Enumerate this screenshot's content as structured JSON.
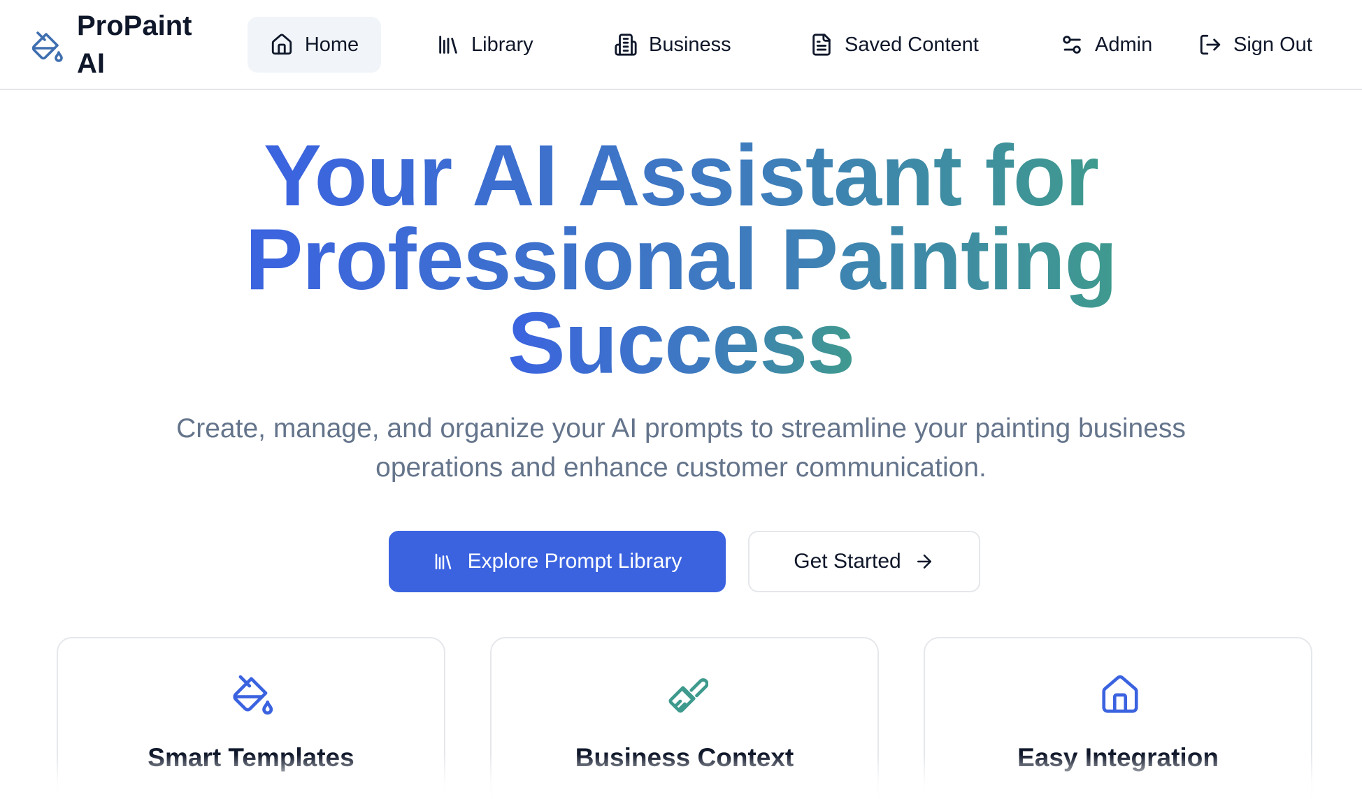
{
  "brand": {
    "name": "ProPaint AI",
    "icon": "paint-bucket-icon",
    "color": "#3b63e0"
  },
  "nav": {
    "items": [
      {
        "label": "Home",
        "icon": "home-icon",
        "active": true
      },
      {
        "label": "Library",
        "icon": "library-icon"
      },
      {
        "label": "Business",
        "icon": "building-icon"
      },
      {
        "label": "Saved Content",
        "icon": "document-icon"
      },
      {
        "label": "Admin",
        "icon": "settings-sliders-icon"
      },
      {
        "label": "Sign Out",
        "icon": "sign-out-icon"
      }
    ]
  },
  "hero": {
    "title_line1": "Your AI Assistant for",
    "title_line2": "Professional Painting",
    "title_line3": "Success",
    "subtitle": "Create, manage, and organize your AI prompts to streamline your painting business operations and enhance customer communication.",
    "primary_button": {
      "label": "Explore Prompt Library",
      "icon": "library-icon"
    },
    "secondary_button": {
      "label": "Get Started",
      "icon": "arrow-right-icon"
    }
  },
  "features": [
    {
      "title": "Smart Templates",
      "icon": "paint-bucket-icon",
      "color": "#3b63e0"
    },
    {
      "title": "Business Context",
      "icon": "paintbrush-icon",
      "color": "#3f9a8e"
    },
    {
      "title": "Easy Integration",
      "icon": "home-icon",
      "color": "#3b63e0"
    }
  ],
  "colors": {
    "primary": "#3b63e0",
    "teal": "#3f9a8e",
    "muted_text": "#64748b",
    "border": "#e5e7eb",
    "active_nav_bg": "#f1f5f9"
  }
}
